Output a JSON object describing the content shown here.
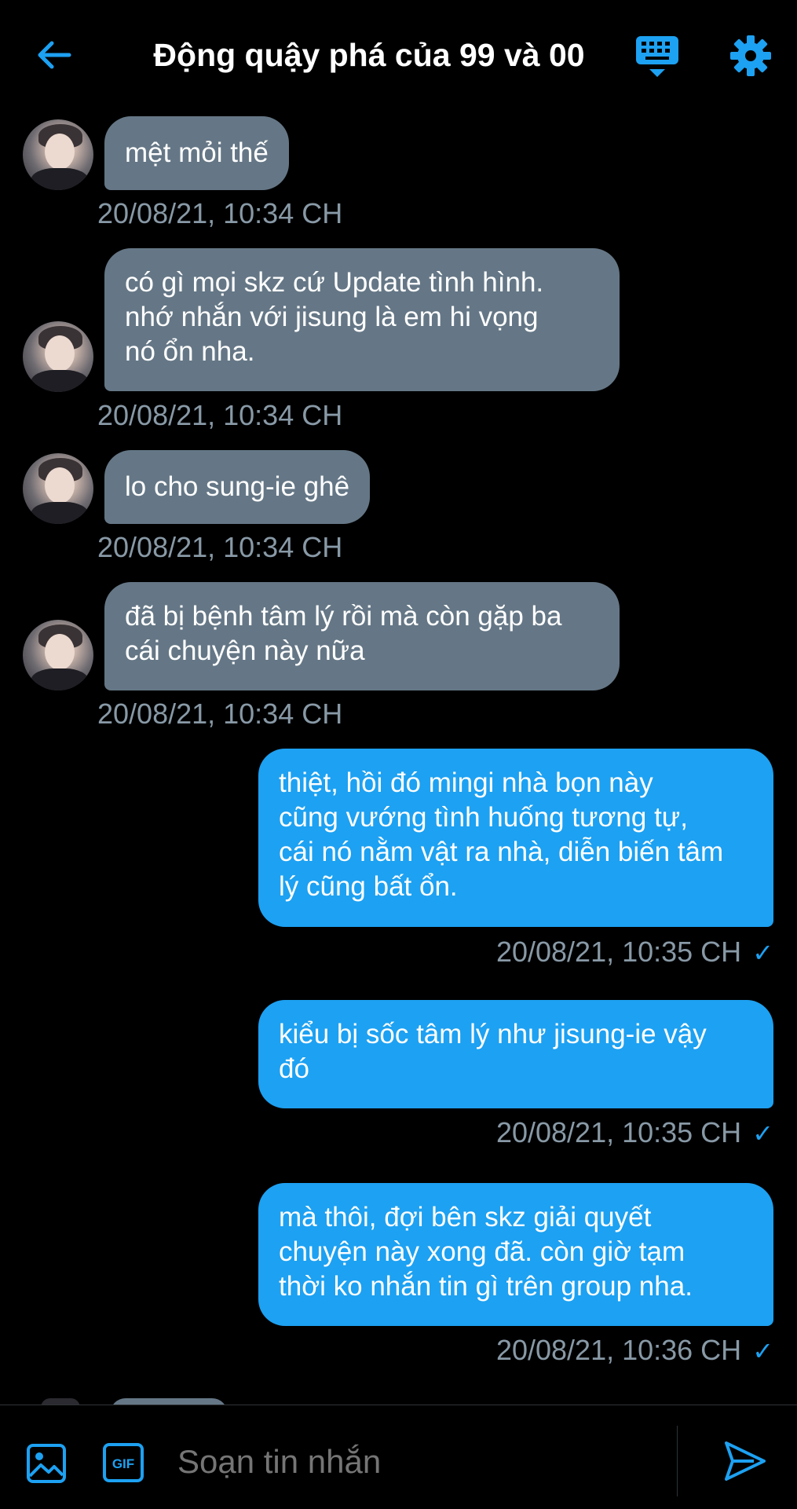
{
  "header": {
    "title": "Động quậy phá của 99 và 00",
    "back_icon": "arrow-left-icon",
    "keyboard_icon": "keyboard-icon",
    "settings_icon": "gear-icon"
  },
  "colors": {
    "accent": "#1da1f2",
    "incoming_bubble": "#657786",
    "timestamp": "#8899a6",
    "background": "#000000"
  },
  "messages": [
    {
      "direction": "in",
      "lines": [
        "mệt mỏi thế"
      ],
      "time": "20/08/21, 10:34 CH"
    },
    {
      "direction": "in",
      "lines": [
        "có gì mọi skz cứ Update tình hình.",
        "nhớ nhắn với jisung là em hi vọng",
        "nó ổn nha."
      ],
      "time": "20/08/21, 10:34 CH"
    },
    {
      "direction": "in",
      "lines": [
        "lo cho sung-ie ghê"
      ],
      "time": "20/08/21, 10:34 CH"
    },
    {
      "direction": "in",
      "lines": [
        "đã bị bệnh tâm lý rồi mà còn gặp ba",
        "cái chuyện này nữa"
      ],
      "time": "20/08/21, 10:34 CH"
    },
    {
      "direction": "out",
      "lines": [
        "thiệt, hồi đó mingi nhà bọn này",
        "cũng vướng tình huống tương tự,",
        "cái nó nằm vật ra nhà, diễn biến tâm",
        "lý cũng bất ổn."
      ],
      "time": "20/08/21, 10:35 CH",
      "status": "✓"
    },
    {
      "direction": "out",
      "lines": [
        "kiểu bị sốc tâm lý như jisung-ie vậy",
        "đó"
      ],
      "time": "20/08/21, 10:35 CH",
      "status": "✓"
    },
    {
      "direction": "out",
      "lines": [
        "mà thôi, đợi bên skz giải quyết",
        "chuyện này xong đã. còn giờ tạm",
        "thời ko nhắn tin gì trên group nha."
      ],
      "time": "20/08/21, 10:36 CH",
      "status": "✓"
    }
  ],
  "composer": {
    "placeholder": "Soạn tin nhắn",
    "image_icon": "image-icon",
    "gif_icon": "gif-icon",
    "gif_label": "GIF",
    "send_icon": "send-icon"
  }
}
